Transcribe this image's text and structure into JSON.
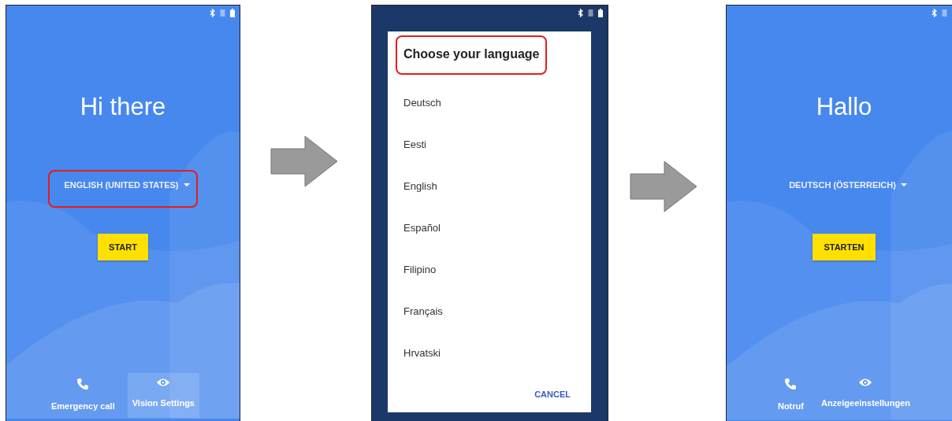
{
  "screens": [
    {
      "kind": "welcome",
      "greeting": "Hi there",
      "language": "ENGLISH (UNITED STATES)",
      "language_highlighted": true,
      "start_button": "START",
      "actions": [
        {
          "label": "Emergency call",
          "focused": false
        },
        {
          "label": "Vision Settings",
          "focused": true
        }
      ]
    },
    {
      "kind": "language_dialog",
      "title": "Choose your language",
      "title_highlighted": true,
      "languages": [
        "Deutsch",
        "Eesti",
        "English",
        "Español",
        "Filipino",
        "Français",
        "Hrvatski"
      ],
      "cancel_button": "CANCEL"
    },
    {
      "kind": "welcome",
      "greeting": "Hallo",
      "language": "DEUTSCH (ÖSTERREICH)",
      "language_highlighted": false,
      "start_button": "STARTEN",
      "actions": [
        {
          "label": "Notruf",
          "focused": false
        },
        {
          "label": "Anzeigeeinstellungen",
          "focused": false
        }
      ]
    }
  ]
}
